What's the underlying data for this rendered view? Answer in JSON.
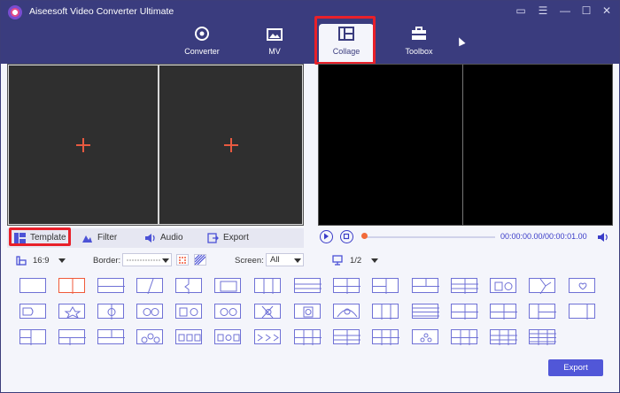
{
  "window": {
    "title": "Aiseesoft Video Converter Ultimate"
  },
  "nav": {
    "tabs": [
      {
        "label": "Converter",
        "icon": "converter-icon"
      },
      {
        "label": "MV",
        "icon": "mv-icon"
      },
      {
        "label": "Collage",
        "icon": "collage-icon",
        "active": true
      },
      {
        "label": "Toolbox",
        "icon": "toolbox-icon"
      }
    ]
  },
  "bottom_tabs": [
    {
      "label": "Template",
      "icon": "template-icon",
      "active": true
    },
    {
      "label": "Filter",
      "icon": "filter-icon"
    },
    {
      "label": "Audio",
      "icon": "audio-icon"
    },
    {
      "label": "Export",
      "icon": "export-icon"
    }
  ],
  "player": {
    "time": "00:00:00.00/00:00:01.00",
    "progress": 0
  },
  "options": {
    "aspect_ratio": "16:9",
    "border_label": "Border:",
    "screen_label": "Screen:",
    "screen_value": "All",
    "page": "1/2"
  },
  "export_button": "Export",
  "colors": {
    "header": "#3a3c7e",
    "accent": "#5157d8",
    "highlight": "#e8202a"
  }
}
